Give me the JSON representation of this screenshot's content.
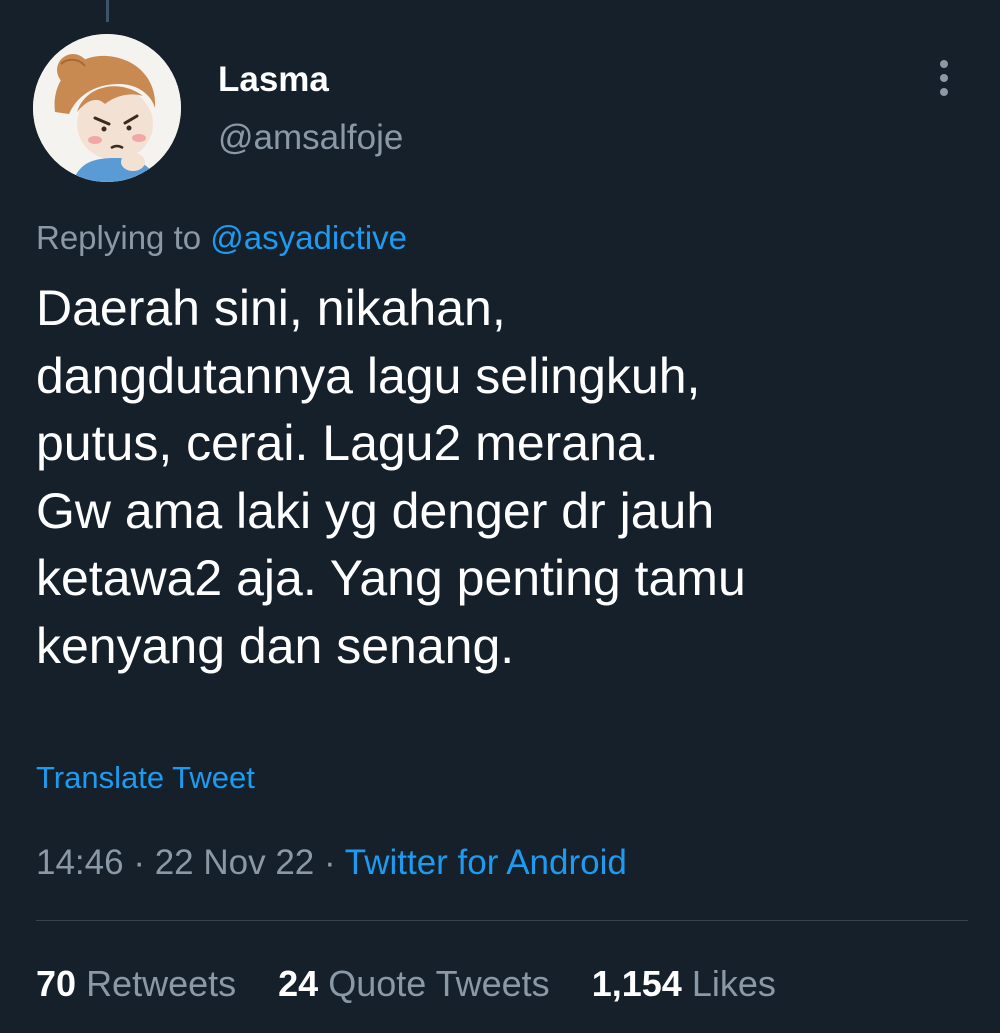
{
  "tweet": {
    "display_name": "Lasma",
    "handle": "@amsalfoje",
    "reply_prefix": "Replying to",
    "reply_to": "@asyadictive",
    "text_lines": [
      "Daerah sini, nikahan,",
      "dangdutannya lagu selingkuh,",
      "putus, cerai. Lagu2 merana.",
      "Gw ama laki yg denger dr jauh",
      "ketawa2 aja. Yang penting tamu",
      "kenyang dan senang."
    ],
    "translate_label": "Translate Tweet",
    "time": "14:46",
    "date": "22 Nov 22",
    "separator": "·",
    "source": "Twitter for Android"
  },
  "stats": [
    {
      "count": "70",
      "label": "Retweets"
    },
    {
      "count": "24",
      "label": "Quote Tweets"
    },
    {
      "count": "1,154",
      "label": "Likes"
    }
  ],
  "icons": {
    "more": "more-vertical-icon",
    "avatar": "cartoon-girl-avatar"
  },
  "colors": {
    "background": "#15202b",
    "text_primary": "#ffffff",
    "text_secondary": "#8b98a5",
    "accent": "#1d9bf0",
    "divider": "#38444d"
  }
}
